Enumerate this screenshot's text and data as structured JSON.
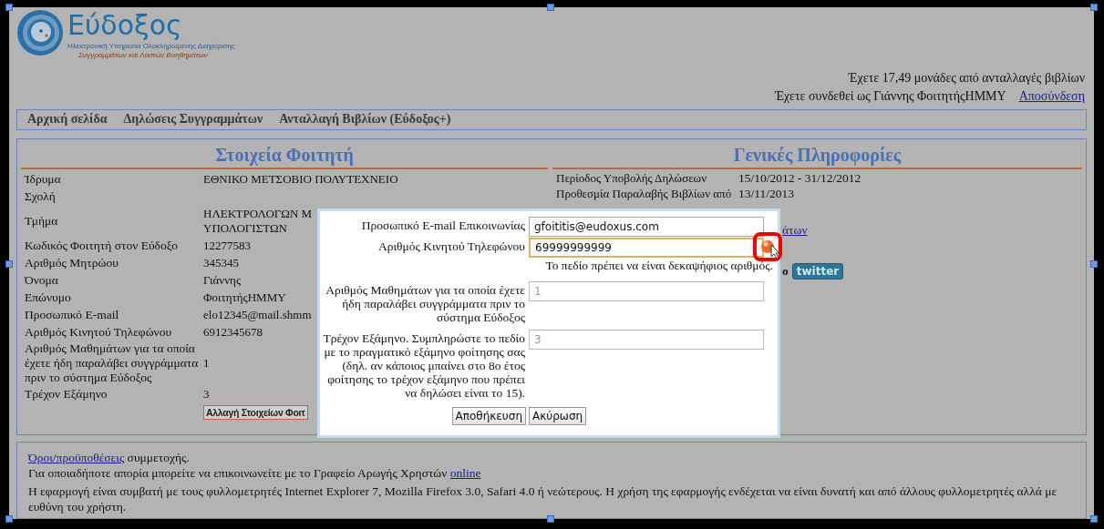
{
  "header": {
    "logo": {
      "title": "Εύδοξος",
      "subtitle_1": "Ηλεκτρονική Υπηρεσία Ολοκληρωμένης Διαχείρισης",
      "subtitle_2": "Συγγραμμάτων και Λοιπών Βοηθημάτων"
    },
    "points_notice": "Έχετε 17,49 μονάδες από ανταλλαγές βιβλίων",
    "login_notice": "Έχετε συνδεθεί ως Γιάννης ΦοιτητήςΗΜΜΥ",
    "logout_link": "Αποσύνδεση"
  },
  "nav": [
    {
      "label": "Αρχική σελίδα"
    },
    {
      "label": "Δηλώσεις Συγγραμμάτων"
    },
    {
      "label": "Ανταλλαγή Βιβλίων (Εύδοξος+)"
    }
  ],
  "student_panel": {
    "title": "Στοιχεία Φοιτητή",
    "rows": [
      {
        "label": "Ίδρυμα",
        "value": "ΕΘΝΙΚΟ ΜΕΤΣΟΒΙΟ ΠΟΛΥΤΕΧΝΕΙΟ"
      },
      {
        "label": "Σχολή"
      },
      {
        "label": "Τμήμα",
        "value": "ΗΛΕΚΤΡΟΛΟΓΩΝ Μ\nΥΠΟΛΟΓΙΣΤΩΝ"
      },
      {
        "label": "Κωδικός Φοιτητή στον Εύδοξο",
        "value": "12277583"
      },
      {
        "label": "Αριθμός Μητρώου",
        "value": "345345"
      },
      {
        "label": "Όνομα",
        "value": "Γιάννης"
      },
      {
        "label": "Επώνυμο",
        "value": "ΦοιτητήςΗΜΜΥ"
      },
      {
        "label": "Προσωπικό E-mail",
        "value": "elo12345@mail.shmm"
      },
      {
        "label": "Αριθμός Κινητού Τηλεφώνου",
        "value": "6912345678"
      },
      {
        "label": "Αριθμός Μαθημάτων για τα οποία έχετε ήδη παραλάβει συγγράμματα πριν το σύστημα Εύδοξος",
        "value": "1"
      },
      {
        "label": "Τρέχον Εξάμηνο",
        "value": "3"
      }
    ],
    "edit_button": "Αλλαγή Στοιχείων Φοιτ"
  },
  "info_panel": {
    "title": "Γενικές Πληροφορίες",
    "rows": [
      {
        "label": "Περίοδος Υποβολής Δηλώσεων",
        "value": "15/10/2012 - 31/12/2012"
      },
      {
        "label": "Προθεσμία Παραλαβής Βιβλίων από",
        "value": "13/11/2013"
      }
    ],
    "link": "άτων",
    "follow_text": "ο",
    "twitter_button": "twitter"
  },
  "dialog": {
    "fields": [
      {
        "label": "Προσωπικό E-mail Επικοινωνίας",
        "value": "gfoititis@eudoxus.com",
        "disabled": false,
        "focused": false
      },
      {
        "label": "Αριθμός Κινητού Τηλεφώνου",
        "value": "69999999999",
        "disabled": false,
        "focused": true,
        "error": "Το πεδίο πρέπει να είναι δεκαψήφιος αριθμός."
      },
      {
        "label": "Αριθμός Μαθημάτων για τα οποία έχετε ήδη παραλάβει συγγράμματα πριν το σύστημα Εύδοξος",
        "value": "1",
        "disabled": true,
        "focused": false
      },
      {
        "label": "Τρέχον Εξάμηνο. Συμπληρώστε το πεδίο με το πραγματικό εξάμηνο φοίτησης σας (δηλ. αν κάποιος μπαίνει στο 8ο έτος φοίτησης το τρέχον εξάμηνο που πρέπει να δηλώσει είναι το 15).",
        "value": "3",
        "disabled": true,
        "focused": false
      }
    ],
    "buttons": [
      "Αποθήκευση",
      "Ακύρωση"
    ]
  },
  "footer": {
    "terms_link": "Όροι/προϋποθέσεις",
    "terms_text": " συμμετοχής.",
    "help_text": "Για οποιαδήποτε απορία μπορείτε να επικοινωνείτε με το Γραφείο Αρωγής Χρηστών ",
    "help_link": "online",
    "compat_text": "Η εφαρμογή είναι συμβατή με τους φυλλομετρητές Internet Explorer 7, Mozilla Firefox 3.0, Safari 4.0 ή νεώτερους. Η χρήση της εφαρμογής ενδέχεται να είναι δυνατή και από άλλους φυλλομετρητές αλλά με ευθύνη του χρήστη."
  }
}
